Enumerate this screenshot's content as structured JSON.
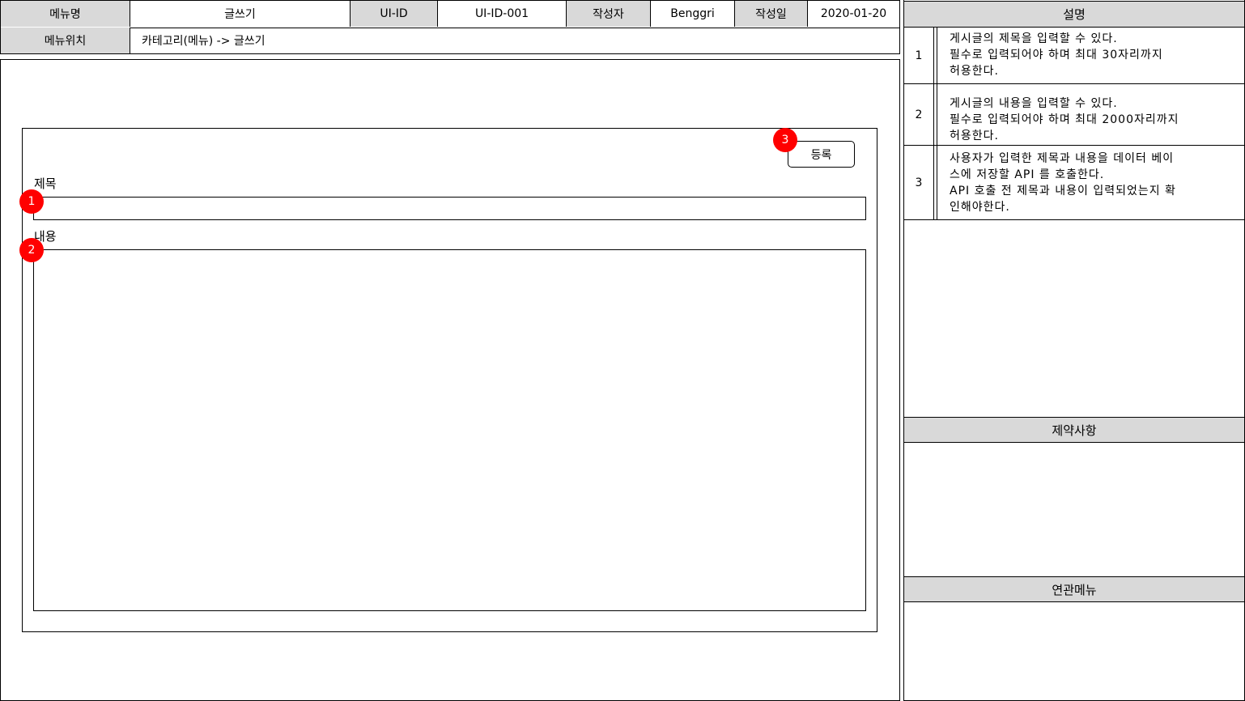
{
  "header": {
    "menu_name_label": "메뉴명",
    "menu_name_value": "글쓰기",
    "ui_id_label": "UI-ID",
    "ui_id_value": "UI-ID-001",
    "author_label": "작성자",
    "author_value": "Benggri",
    "date_label": "작성일",
    "date_value": "2020-01-20",
    "location_label": "메뉴위치",
    "location_value": "카테고리(메뉴) -> 글쓰기"
  },
  "form": {
    "title_label": "제목",
    "content_label": "내용",
    "submit_label": "등록",
    "title_value": "",
    "content_value": ""
  },
  "markers": [
    "1",
    "2",
    "3"
  ],
  "panel": {
    "description_title": "설명",
    "descriptions": [
      {
        "num": "1",
        "text": "게시글의 제목을 입력할 수 있다.\n필수로 입력되어야 하며 최대 30자리까지\n허용한다."
      },
      {
        "num": "2",
        "text": "게시글의 내용을 입력할 수 있다.\n필수로 입력되어야 하며 최대 2000자리까지\n허용한다."
      },
      {
        "num": "3",
        "text": "사용자가 입력한 제목과 내용을 데이터 베이\n스에 저장할 API 를 호출한다.\nAPI 호출 전 제목과 내용이 입력되었는지 확\n인해야한다."
      }
    ],
    "constraints_title": "제약사항",
    "related_menu_title": "연관메뉴"
  }
}
